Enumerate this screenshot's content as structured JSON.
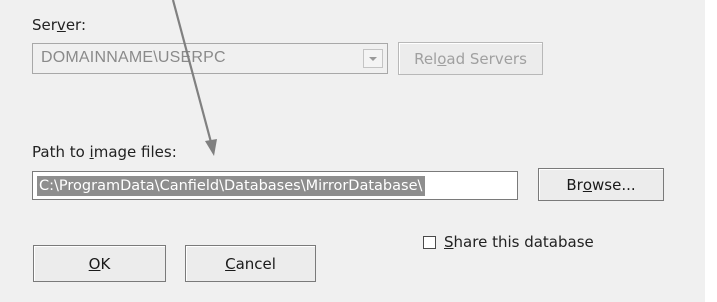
{
  "server": {
    "label_pre": "Ser",
    "label_ul": "v",
    "label_post": "er:",
    "value": "DOMAINNAME\\USERPC",
    "reload_pre": "Rel",
    "reload_ul": "o",
    "reload_post": "ad Servers"
  },
  "path": {
    "label_pre": "Path to ",
    "label_ul": "i",
    "label_post": "mage files:",
    "value": "C:\\ProgramData\\Canfield\\Databases\\MirrorDatabase\\",
    "browse_pre": "Br",
    "browse_ul": "o",
    "browse_post": "wse..."
  },
  "share": {
    "label_ul": "S",
    "label_post": "hare this database",
    "checked": false
  },
  "buttons": {
    "ok_ul": "O",
    "ok_post": "K",
    "cancel_ul": "C",
    "cancel_post": "ancel"
  },
  "annotation": {
    "arrow_color": "#808080",
    "arrow_icon": "pointer-arrow"
  }
}
